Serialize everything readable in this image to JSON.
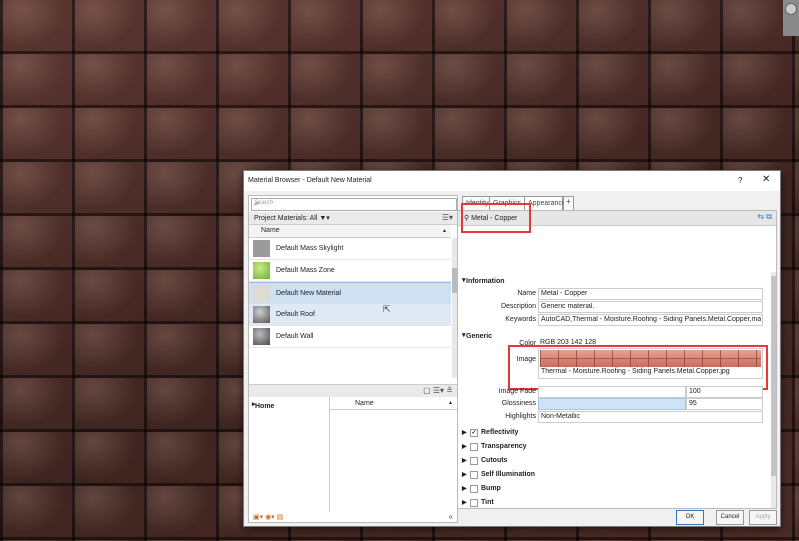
{
  "colors": {
    "highlight": "#e53a3a",
    "selection": "#cfe0f3",
    "accent": "#3a72c0"
  },
  "dialog": {
    "title": "Material Browser - Default New Material",
    "help": "?",
    "close": "✕"
  },
  "left": {
    "search_placeholder": "Search",
    "project_materials": "Project Materials: All",
    "filter_icon": "funnel-icon",
    "column_name": "Name",
    "materials": [
      {
        "name": "Default Mass Skylight",
        "swatch": "#9b9b9b"
      },
      {
        "name": "Default Mass Zone",
        "swatch": "#8ec64e"
      },
      {
        "name": "Default New Material",
        "swatch": "#d9d6cf",
        "selected": true
      },
      {
        "name": "Default Roof",
        "swatch": "#7a7a7a"
      },
      {
        "name": "Default Wall",
        "swatch": "#6d6d6d"
      }
    ],
    "library_tree": "Home",
    "library_column": "Name"
  },
  "tabs": [
    "Identity",
    "Graphics",
    "Appearance"
  ],
  "asset": {
    "name": "Metal - Copper"
  },
  "information": {
    "header": "Information",
    "name_label": "Name",
    "name_value": "Metal - Copper",
    "description_label": "Description",
    "description_value": "Generic material.",
    "keywords_label": "Keywords",
    "keywords_value": "AutoCAD,Thermal - Moisture.Roofing - Siding Panels.Metal.Copper,material..."
  },
  "generic": {
    "header": "Generic",
    "color_label": "Color",
    "color_value": "RGB 203 142 128",
    "image_label": "Image",
    "image_filename": "Thermal - Moisture.Roofing - Siding Panels.Metal.Copper.jpg",
    "image_fade_label": "Image Fade",
    "image_fade_value": "100",
    "glossiness_label": "Glossiness",
    "glossiness_value": "95",
    "highlights_label": "Highlights",
    "highlights_value": "Non-Metallic"
  },
  "sections": [
    {
      "label": "Reflectivity",
      "checked": true
    },
    {
      "label": "Transparency",
      "checked": false
    },
    {
      "label": "Cutouts",
      "checked": false
    },
    {
      "label": "Self Illumination",
      "checked": false
    },
    {
      "label": "Bump",
      "checked": false
    },
    {
      "label": "Tint",
      "checked": false
    }
  ],
  "buttons": {
    "ok": "OK",
    "cancel": "Cancel",
    "apply": "Apply"
  }
}
